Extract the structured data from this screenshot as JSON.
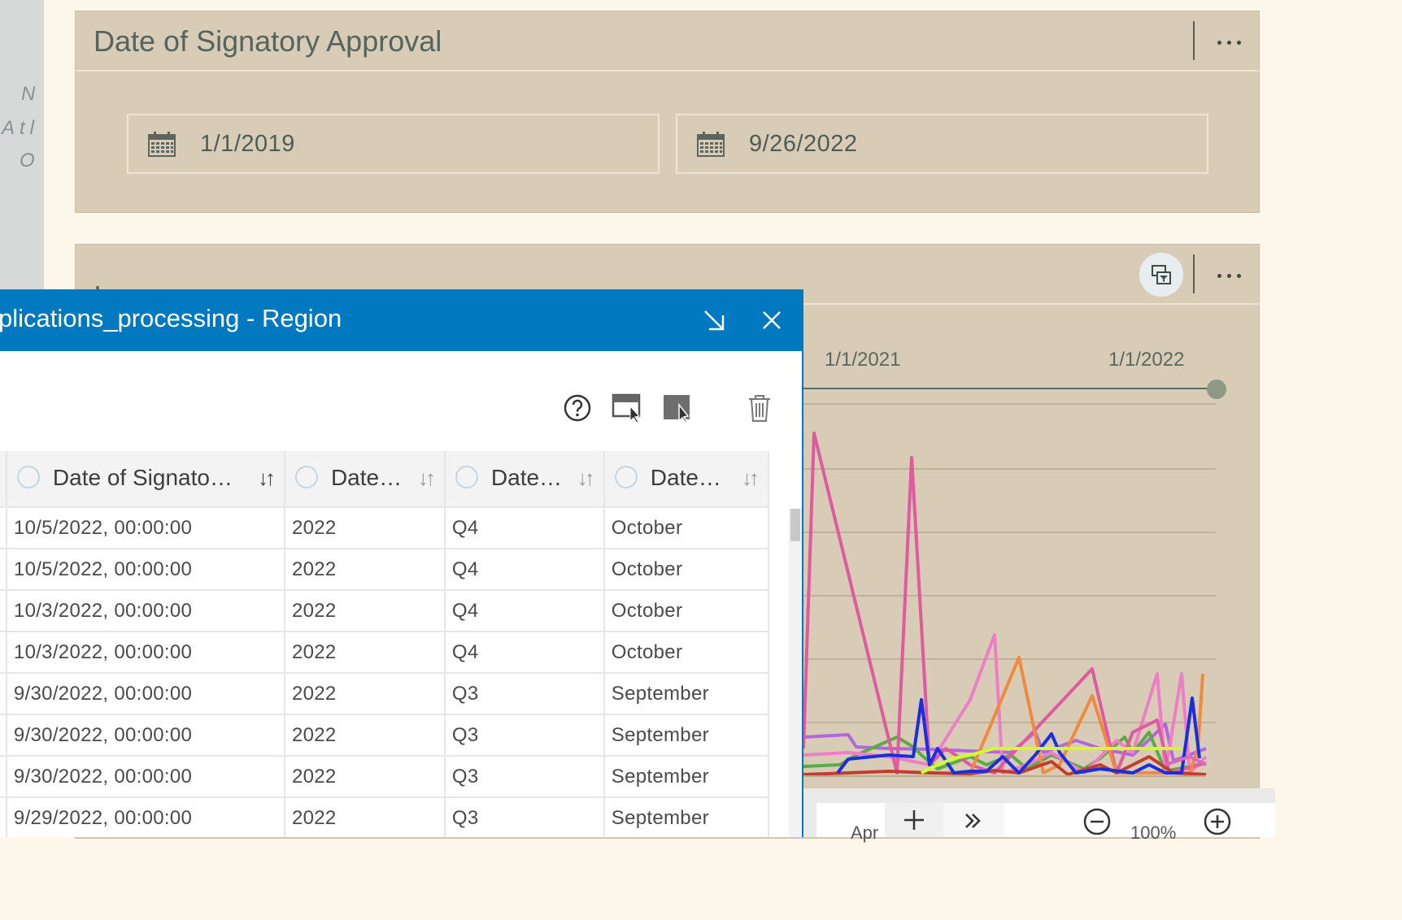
{
  "left_strip": {
    "fragments": [
      "N",
      "Atl",
      "O"
    ]
  },
  "date_panel": {
    "title": "Date of Signatory Approval",
    "start_date": "1/1/2019",
    "end_date": "9/26/2022"
  },
  "chart_panel": {
    "title": ".",
    "timeline_labels": [
      "1/1/2021",
      "1/1/2022"
    ],
    "bottom_bar": {
      "partial_label": "Apr",
      "zoom": "100%"
    }
  },
  "table_window": {
    "title": "plications_processing - Region",
    "columns": [
      {
        "label": "Date of Signato…"
      },
      {
        "label": "Date…"
      },
      {
        "label": "Date…"
      },
      {
        "label": "Date…"
      }
    ],
    "rows": [
      [
        "10/5/2022, 00:00:00",
        "2022",
        "Q4",
        "October"
      ],
      [
        "10/5/2022, 00:00:00",
        "2022",
        "Q4",
        "October"
      ],
      [
        "10/3/2022, 00:00:00",
        "2022",
        "Q4",
        "October"
      ],
      [
        "10/3/2022, 00:00:00",
        "2022",
        "Q4",
        "October"
      ],
      [
        "9/30/2022, 00:00:00",
        "2022",
        "Q3",
        "September"
      ],
      [
        "9/30/2022, 00:00:00",
        "2022",
        "Q3",
        "September"
      ],
      [
        "9/30/2022, 00:00:00",
        "2022",
        "Q3",
        "September"
      ],
      [
        "9/29/2022, 00:00:00",
        "2022",
        "Q3",
        "September"
      ]
    ]
  },
  "colors": {
    "panel_bg": "#d8ccb7",
    "page_bg": "#fdf6ea",
    "window_header": "#0079c1",
    "series": [
      "#e05aa0",
      "#ef7ec8",
      "#f08a3c",
      "#1a2de0",
      "#d0ff2a",
      "#5aaa46",
      "#c23d2e",
      "#b266e0"
    ]
  },
  "icons": [
    "calendar-icon",
    "more-icon",
    "filter-icon",
    "minimize-icon",
    "close-icon",
    "help-icon",
    "select-area-icon",
    "select-icon",
    "trash-icon",
    "sort-icon",
    "plus-icon",
    "chevron-right-icon",
    "zoom-out-icon",
    "zoom-in-icon"
  ]
}
